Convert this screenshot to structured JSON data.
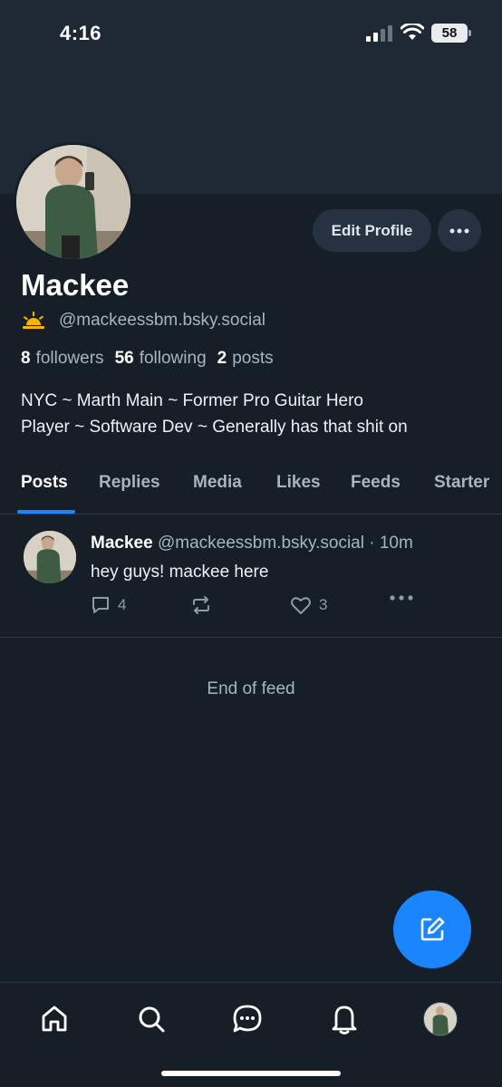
{
  "status_bar": {
    "time": "4:16",
    "battery": "58"
  },
  "profile": {
    "display_name": "Mackee",
    "handle": "@mackeessbm.bsky.social",
    "badge_emoji": "🌅",
    "stats": {
      "followers_count": "8",
      "followers_label": "followers",
      "following_count": "56",
      "following_label": "following",
      "posts_count": "2",
      "posts_label": "posts"
    },
    "bio_line1": "NYC ~ Marth Main ~ Former Pro Guitar Hero",
    "bio_line2": "Player ~ Software Dev ~ Generally has that shit on",
    "edit_button": "Edit Profile"
  },
  "tabs": [
    {
      "label": "Posts",
      "active": true
    },
    {
      "label": "Replies"
    },
    {
      "label": "Media"
    },
    {
      "label": "Likes"
    },
    {
      "label": "Feeds"
    },
    {
      "label": "Starter"
    }
  ],
  "post": {
    "author": "Mackee",
    "handle": "@mackeessbm.bsky.social",
    "time": "· 10m",
    "text": "hey guys! mackee here",
    "reply_count": "4",
    "like_count": "3"
  },
  "feed_end": "End of feed",
  "colors": {
    "accent": "#1a85ff",
    "background": "#161e27",
    "banner": "#1e2935"
  },
  "icons": [
    "home-icon",
    "search-icon",
    "chat-icon",
    "bell-icon",
    "compose-icon",
    "reply-icon",
    "repost-icon",
    "like-icon",
    "more-icon"
  ]
}
